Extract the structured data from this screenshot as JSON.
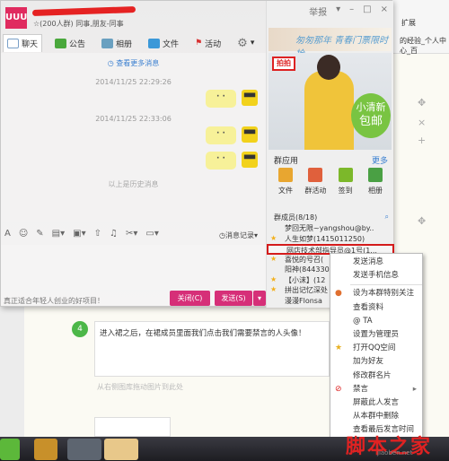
{
  "window": {
    "logo": "UUU",
    "subtitle": "☆(200人群) 同事,朋友-同事",
    "controls": [
      "举报",
      "▾",
      "–",
      "□",
      "×"
    ]
  },
  "tabs": [
    {
      "label": "聊天",
      "icon": "chat-icon",
      "color": "#7aa0c8"
    },
    {
      "label": "公告",
      "icon": "megaphone-icon",
      "color": "#4aa83c"
    },
    {
      "label": "相册",
      "icon": "photo-icon",
      "color": "#6aa0c0"
    },
    {
      "label": "文件",
      "icon": "folder-icon",
      "color": "#3b98d8"
    },
    {
      "label": "活动",
      "icon": "flag-icon",
      "color": "#d83030"
    }
  ],
  "chat": {
    "more": "查看更多消息",
    "messages": [
      {
        "time": "2014/11/25 22:29:26",
        "content": "· ·"
      },
      {
        "time": "2014/11/25 22:33:06",
        "content": "· ·"
      }
    ],
    "extra_bubble": "· ·",
    "history": "以上是历史消息"
  },
  "toolbar": {
    "icons": [
      "font-icon",
      "emoji-icon",
      "magic-icon",
      "screenshot-icon",
      "image-icon",
      "upload-icon",
      "music-icon",
      "scissors-icon",
      "more-icon"
    ],
    "record": "消息记录"
  },
  "footer": {
    "ad": "真正适合年轻人创业的好项目！",
    "close": "关闭(C)",
    "send": "发送(S)"
  },
  "panel": {
    "banner": "匆匆那年 青春门票限时抢",
    "ad_badge": "拍拍",
    "ad_text1": "小清新",
    "ad_text2": "包邮",
    "apps_title": "群应用",
    "apps_more": "更多",
    "apps": [
      {
        "label": "文件",
        "color": "#e8a630"
      },
      {
        "label": "群活动",
        "color": "#e0603c"
      },
      {
        "label": "签到",
        "color": "#7cb82a"
      },
      {
        "label": "相册",
        "color": "#4aa044"
      }
    ],
    "members_title": "群成员(8/18)",
    "members": [
      {
        "name": "梦回无限~yangshou@by..",
        "star": false
      },
      {
        "name": "人生如梦(1415011250)",
        "star": true
      },
      {
        "name": "网店技术部指导员@1号(1...",
        "star": false,
        "selected": true
      },
      {
        "name": "喜悦的号召(",
        "star": true
      },
      {
        "name": "阳神(844330",
        "star": false
      },
      {
        "name": "【小沫】(12",
        "star": true
      },
      {
        "name": "拼出记忆深处",
        "star": true
      },
      {
        "name": "漫漫Flonsa",
        "star": false
      }
    ]
  },
  "context_menu": [
    {
      "label": "发送消息"
    },
    {
      "label": "发送手机信息"
    },
    {
      "sep": true
    },
    {
      "label": "设为本群特别关注",
      "icon": "follow-icon"
    },
    {
      "label": "查看资料"
    },
    {
      "label": "@ TA"
    },
    {
      "label": "设置为管理员"
    },
    {
      "label": "打开QQ空间",
      "icon": "star-icon"
    },
    {
      "label": "加为好友"
    },
    {
      "label": "修改群名片"
    },
    {
      "label": "禁言",
      "icon": "mute-icon",
      "submenu": true
    },
    {
      "label": "屏蔽此人发言"
    },
    {
      "label": "从本群中删除"
    },
    {
      "label": "查看最后发言时间"
    }
  ],
  "web": {
    "tab_fragment": "的经验_个人中心_百",
    "extend": "扩展",
    "step": "4",
    "step_text": "进入裙之后，在裙成员里面我们点击我们需要禁言的人头像！",
    "hint": "从右侧图库拖动图片到此处"
  },
  "watermark": "脚本之家",
  "watermark_sub": "jiaoben.net"
}
